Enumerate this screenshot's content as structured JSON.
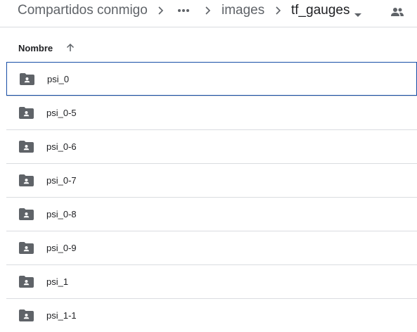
{
  "breadcrumb": {
    "root": "Compartidos conmigo",
    "folder": "images",
    "current": "tf_gauges"
  },
  "icons": {
    "separator": "chevron-right-icon",
    "more": "more-horiz-icon",
    "caret": "caret-down-icon",
    "shared": "people-icon",
    "sort": "arrow-upward-icon",
    "folder": "shared-folder-icon"
  },
  "colors": {
    "selection_border": "#174ea6",
    "folder_icon": "#5f6368",
    "divider": "#dadce0"
  },
  "list": {
    "sort_label": "Nombre",
    "sort_direction": "ascending",
    "items": [
      {
        "name": "psi_0",
        "selected": true
      },
      {
        "name": "psi_0-5",
        "selected": false
      },
      {
        "name": "psi_0-6",
        "selected": false
      },
      {
        "name": "psi_0-7",
        "selected": false
      },
      {
        "name": "psi_0-8",
        "selected": false
      },
      {
        "name": "psi_0-9",
        "selected": false
      },
      {
        "name": "psi_1",
        "selected": false
      },
      {
        "name": "psi_1-1",
        "selected": false
      }
    ]
  }
}
